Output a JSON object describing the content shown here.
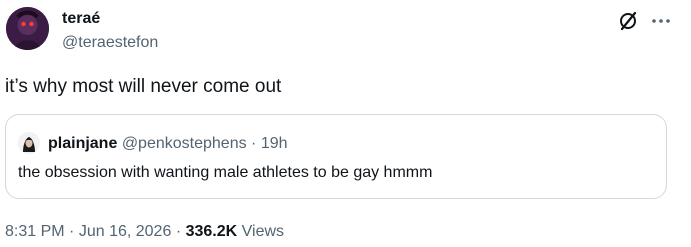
{
  "author": {
    "name": "teraé",
    "handle": "@teraestefon"
  },
  "tweet": {
    "text": "it’s why most will never come out"
  },
  "quote": {
    "name": "plainjane",
    "handle": "@penkostephens",
    "separator": "·",
    "time": "19h",
    "text": "the obsession with wanting male athletes to be gay hmmm"
  },
  "meta": {
    "time": "8:31 PM",
    "separator": "·",
    "date": "Jun 16, 2026",
    "separator2": "·",
    "views_count": "336.2K",
    "views_label": "Views"
  },
  "icons": {
    "grok": "grok-icon",
    "more": "more-horizontal-icon"
  },
  "colors": {
    "text_primary": "#0f1419",
    "text_secondary": "#536471",
    "border": "#cfd9de"
  }
}
